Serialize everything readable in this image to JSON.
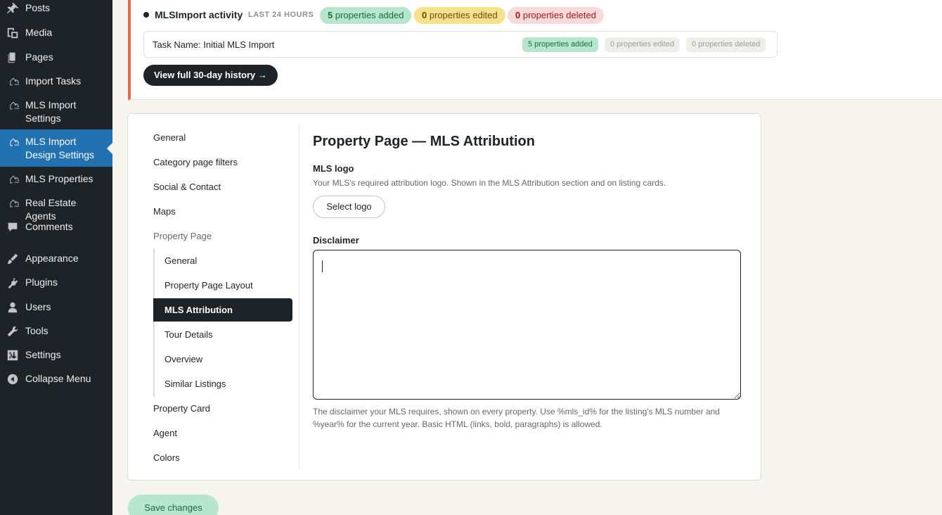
{
  "sidebar": {
    "items": [
      {
        "label": "Posts",
        "icon": "pushpin-icon"
      },
      {
        "label": "Media",
        "icon": "media-icon"
      },
      {
        "label": "Pages",
        "icon": "pages-icon"
      },
      {
        "label": "Import Tasks",
        "icon": "cloud-home-icon"
      },
      {
        "label": "MLS Import Settings",
        "icon": "cloud-home-icon"
      },
      {
        "label": "MLS Import Design Settings",
        "icon": "cloud-home-icon"
      },
      {
        "label": "MLS Properties",
        "icon": "cloud-home-icon"
      },
      {
        "label": "Real Estate Agents",
        "icon": "cloud-home-icon"
      },
      {
        "label": "Comments",
        "icon": "comment-icon"
      },
      {
        "label": "Appearance",
        "icon": "paintbrush-icon"
      },
      {
        "label": "Plugins",
        "icon": "plugin-icon"
      },
      {
        "label": "Users",
        "icon": "user-icon"
      },
      {
        "label": "Tools",
        "icon": "wrench-icon"
      },
      {
        "label": "Settings",
        "icon": "sliders-icon"
      },
      {
        "label": "Collapse Menu",
        "icon": "collapse-icon"
      }
    ]
  },
  "activity": {
    "title": "MLSImport activity",
    "subtitle": "LAST 24 HOURS",
    "added": {
      "count": "5",
      "label": "properties added"
    },
    "edited": {
      "count": "0",
      "label": "properties edited"
    },
    "deleted": {
      "count": "0",
      "label": "properties deleted"
    },
    "task": {
      "name": "Task Name: Initial MLS Import",
      "added": "5 properties added",
      "edited": "0 properties edited",
      "deleted": "0 properties deleted"
    },
    "history_button": "View full 30-day history →"
  },
  "settings_nav": {
    "general": "General",
    "category_filters": "Category page filters",
    "social": "Social & Contact",
    "maps": "Maps",
    "property_page": "Property Page",
    "sub": [
      "General",
      "Property Page Layout",
      "MLS Attribution",
      "Tour Details",
      "Overview",
      "Similar Listings"
    ],
    "property_card": "Property Card",
    "agent": "Agent",
    "colors": "Colors"
  },
  "content": {
    "title": "Property Page — MLS Attribution",
    "logo_label": "MLS logo",
    "logo_help": "Your MLS's required attribution logo. Shown in the MLS Attribution section and on listing cards.",
    "logo_button": "Select logo",
    "disclaimer_label": "Disclaimer",
    "disclaimer_value": "",
    "disclaimer_help_1": "The disclaimer your MLS requires, shown on every property. Use %mls_id% for the listing's MLS number and",
    "disclaimer_help_2": "%year% for the current year. Basic HTML (links, bold, paragraphs) is allowed."
  },
  "save_button": "Save changes",
  "colors": {
    "accent": "#2271b1",
    "notice_border": "#e06b4c"
  }
}
